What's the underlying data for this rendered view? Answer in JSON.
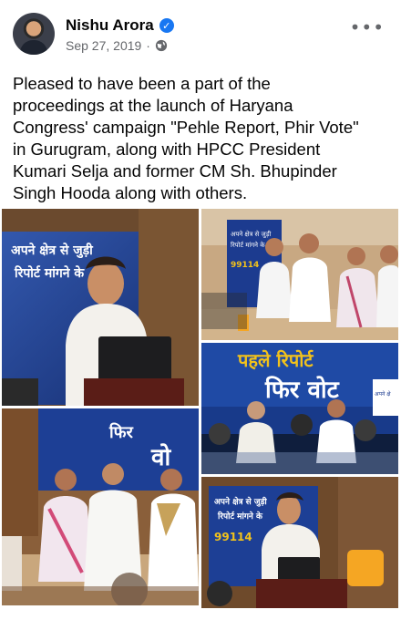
{
  "post": {
    "author": "Nishu Arora",
    "verified_glyph": "✓",
    "date": "Sep 27, 2019",
    "separator": "·",
    "privacy_icon": "globe-icon",
    "more_icon": "more-options-icon",
    "more_glyph": "•••",
    "text": "Pleased to have been a part of the\nproceedings at the launch of Haryana\nCongress' campaign \"Pehle Report, Phir Vote\"\nin Gurugram, along with HPCC President\nKumari Selja  and former CM Sh. Bhupinder\nSingh Hooda along with others."
  },
  "photos": {
    "banner_1": "पहले रिपोर्ट",
    "banner_2": "फिर वोट",
    "banner_small_1": "अपने क्षेत्र से जुड़ी",
    "banner_small_2": "रिपोर्ट मांगने के",
    "banner_number": "99114",
    "banner_fragment": "फिर",
    "banner_fragment_2": "वो",
    "banner_side": "अपने क्षे"
  },
  "colors": {
    "brand_blue": "#1877f2",
    "banner_blue": "#1f3f8f",
    "banner_yellow": "#f2c21b"
  }
}
